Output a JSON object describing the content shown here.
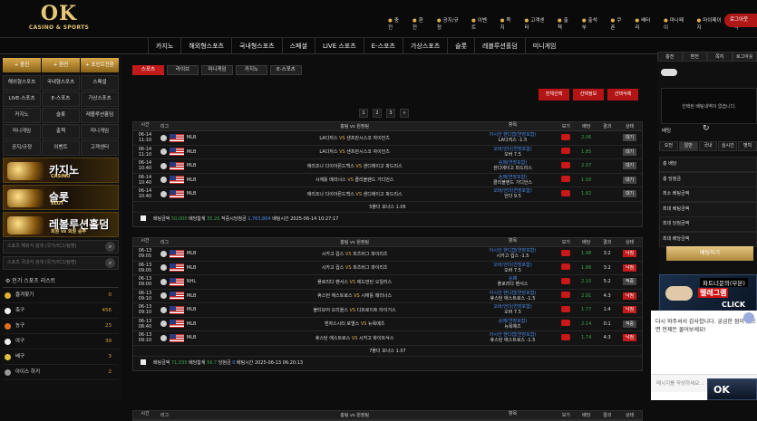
{
  "logo": {
    "main": "OK",
    "sub": "CASINO & SPORTS"
  },
  "top_menu": [
    "충전",
    "환전",
    "공지/규정",
    "이벤트",
    "쪽지",
    "고객센터",
    "출첵",
    "출석부",
    "쿠폰",
    "배터리",
    "마나페이",
    "마이페이지",
    "베팅내역"
  ],
  "logout": "로그아웃",
  "nav": [
    "카지노",
    "해외형스포츠",
    "국내형스포츠",
    "스페셜",
    "LIVE 스포츠",
    "E-스포츠",
    "가상스포츠",
    "슬롯",
    "레볼루션홀덤",
    "미니게임"
  ],
  "left": {
    "btns": [
      "충전",
      "환전",
      "포인트전환"
    ],
    "grid": [
      "해외형스포츠",
      "국내형스포츠",
      "스페셜",
      "LIVE-스포츠",
      "E-스포츠",
      "가상스포츠",
      "카지노",
      "슬롯",
      "레볼루션홀덤",
      "미니게임",
      "출첵",
      "미니게임",
      "공지/규정",
      "이벤트",
      "고객센터"
    ],
    "banners": [
      {
        "title": "카지노",
        "sub": "CASINO"
      },
      {
        "title": "슬롯",
        "sub": "SLOT"
      },
      {
        "title": "레볼루션홀덤",
        "sub": "회원 vs 회원 승부"
      }
    ],
    "search1": "스포츠 해외식 검색 (국가/리그/팀명)",
    "search2": "스포츠 국내식 검색 (국가/리그/팀명)",
    "pop_title": "인기 스포츠 리스트",
    "sports": [
      {
        "name": "즐겨찾기",
        "count": "0",
        "color": "#e0b030"
      },
      {
        "name": "축구",
        "count": "456",
        "color": "#eee"
      },
      {
        "name": "농구",
        "count": "23",
        "color": "#e07020"
      },
      {
        "name": "야구",
        "count": "39",
        "color": "#eee"
      },
      {
        "name": "배구",
        "count": "3",
        "color": "#e0c040"
      },
      {
        "name": "아이스 하키",
        "count": "2",
        "color": "#999"
      }
    ]
  },
  "tabs": [
    "스포츠",
    "라이브",
    "미니게임",
    "카지노",
    "E-스포츠"
  ],
  "actions": [
    "전체선택",
    "선택정보",
    "선택삭제"
  ],
  "pages": [
    "1",
    "2",
    "3",
    "»"
  ],
  "table_headers": [
    "시간",
    "리그",
    "홈팀 vs 원정팀",
    "항목",
    "보기",
    "배당",
    "결과",
    "상태"
  ],
  "tables": [
    {
      "rows": [
        {
          "date": "06-14",
          "time": "11:10",
          "league": "MLB",
          "home": "LA다저스",
          "away": "샌프란시스코 자이언츠",
          "m1": "아시안 핸디캡(연장포함)",
          "m2": "LA다저스 -1.5",
          "odds": "2.06",
          "res": "",
          "stat": "대기",
          "sc": "btn",
          "oc": "grn"
        },
        {
          "date": "06-14",
          "time": "11:10",
          "league": "MLB",
          "home": "LA다저스",
          "away": "샌프란시스코 자이언츠",
          "m1": "오버/언더(연장포함)",
          "m2": "오버 7.5",
          "odds": "1.85",
          "res": "",
          "stat": "대기",
          "sc": "btn",
          "oc": "grn"
        },
        {
          "date": "06-14",
          "time": "10:40",
          "league": "MLB",
          "home": "애리조나 다이아몬드백스",
          "away": "샌디에이고 파드리스",
          "m1": "승패(연장포함)",
          "m2": "샌디에이고 파드리스",
          "odds": "2.07",
          "res": "",
          "stat": "대기",
          "sc": "btn",
          "oc": "grn"
        },
        {
          "date": "06-14",
          "time": "10:40",
          "league": "MLB",
          "home": "시애틀 매리너스",
          "away": "클리블랜드 가디언스",
          "m1": "승패(연장포함)",
          "m2": "클리블랜드 가디언스",
          "odds": "1.50",
          "res": "",
          "stat": "대기",
          "sc": "btn",
          "oc": "grn"
        },
        {
          "date": "06-14",
          "time": "10:40",
          "league": "MLB",
          "home": "애리조나 다이아몬드백스",
          "away": "샌디에이고 파드리스",
          "m1": "오버/언더(연장포함)",
          "m2": "언더 9.5",
          "odds": "1.82",
          "res": "",
          "stat": "대기",
          "sc": "btn",
          "oc": "grn"
        }
      ],
      "sum": "5폴더 보너스 1.05",
      "info": {
        "amount_label": "배팅금액",
        "amount": "50,000",
        "odds_label": "배당합계",
        "odds": "35.26",
        "win_label": "적중시당첨금",
        "win": "1,763,804",
        "time_label": "배팅시간",
        "time": "2025-06-14 10:27:17"
      }
    },
    {
      "rows": [
        {
          "date": "06-13",
          "time": "09:05",
          "league": "MLB",
          "home": "시카고 컵스",
          "away": "피츠버그 파이리츠",
          "m1": "아시안 핸디캡(연장포함)",
          "m2": "시카고 컵스 -1.5",
          "odds": "1.98",
          "res": "3:2",
          "stat": "낙첨",
          "sc": "btn r",
          "oc": "grn"
        },
        {
          "date": "06-13",
          "time": "09:05",
          "league": "MLB",
          "home": "시카고 컵스",
          "away": "피츠버그 파이리츠",
          "m1": "오버/언더(연장포함)",
          "m2": "오버 7.5",
          "odds": "1.86",
          "res": "3:2",
          "stat": "낙첨",
          "sc": "btn r",
          "oc": "grn"
        },
        {
          "date": "06-13",
          "time": "09:00",
          "league": "NHL",
          "home": "플로리다 팬서스",
          "away": "에드먼턴 오일러스",
          "m1": "승패",
          "m2": "플로리다 팬서스",
          "odds": "2.10",
          "res": "5:2",
          "stat": "적중",
          "sc": "btn",
          "oc": "grn"
        },
        {
          "date": "06-13",
          "time": "09:10",
          "league": "MLB",
          "home": "휴스턴 애스트로스",
          "away": "시애틀 매리너스",
          "m1": "아시안 핸디캡(연장포함)",
          "m2": "휴스턴 애스트로스 -1.5",
          "odds": "2.91",
          "res": "4:3",
          "stat": "낙첨",
          "sc": "btn r",
          "oc": "grn"
        },
        {
          "date": "06-13",
          "time": "09:10",
          "league": "MLB",
          "home": "볼티모어 오리올스",
          "away": "디트로이트 타이거스",
          "m1": "오버/언더(연장포함)",
          "m2": "오버 7.5",
          "odds": "1.77",
          "res": "1:4",
          "stat": "낙첨",
          "sc": "btn r",
          "oc": "grn"
        },
        {
          "date": "06-13",
          "time": "08:40",
          "league": "MLB",
          "home": "캔자스시티 로열스",
          "away": "뉴욕메츠",
          "m1": "승패(연장포함)",
          "m2": "뉴욕메츠",
          "odds": "2.14",
          "res": "0:1",
          "stat": "적중",
          "sc": "btn",
          "oc": "grn"
        },
        {
          "date": "06-13",
          "time": "09:10",
          "league": "MLB",
          "home": "휴스턴 애스트로스",
          "away": "시카고 화이트삭스",
          "m1": "아시안 핸디캡(연장포함)",
          "m2": "휴스턴 애스트로스 -1.5",
          "odds": "1.74",
          "res": "4:3",
          "stat": "낙첨",
          "sc": "btn r",
          "oc": "grn"
        }
      ],
      "sum": "7폴더 보너스 1.07",
      "info": {
        "amount_label": "배팅금액",
        "amount": "71,035",
        "odds_label": "배당합계",
        "odds": "56.7",
        "win_label": "당첨금",
        "win": "0",
        "time_label": "배팅시간",
        "time": "2025-06-13 06:20:13"
      }
    }
  ],
  "right": {
    "tabs": [
      "충전",
      "환전",
      "쪽지",
      "로그아웃"
    ],
    "msg": "선택된 배팅내역이 없습니다.",
    "label": "배팅",
    "tabs2": [
      "오전",
      "일반",
      "국내",
      "실시간",
      "벳빅"
    ],
    "rows": [
      "총 배당",
      "총 당첨금",
      "최소 베팅금액",
      "최대 베팅금액",
      "최대 당첨금액",
      "최대 배당금액"
    ],
    "bet": "배팅하기",
    "banner": {
      "a": "파트너문의(부본)",
      "b": "텔레그램",
      "c": "OKBET",
      "d": "CLICK"
    }
  },
  "chat": {
    "msg": "다시 와주셔서 감사합니다. 궁금한 점이 있으면 언제든 물어보세요!",
    "placeholder": "메시지를 작성하세요..."
  },
  "okbot": "OK"
}
